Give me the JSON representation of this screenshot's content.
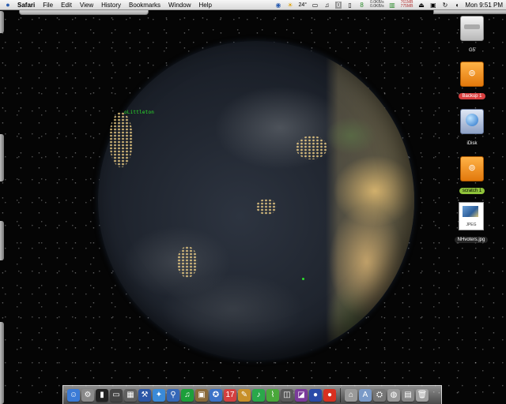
{
  "menubar": {
    "apple": "",
    "items": [
      "Safari",
      "File",
      "Edit",
      "View",
      "History",
      "Bookmarks",
      "Window",
      "Help"
    ],
    "extras": {
      "weather": "24°",
      "net_down": "0.0KB/s",
      "net_up": "0.0KB/s",
      "mem_a": "761MB",
      "mem_b": "775MB",
      "clock": "Mon 9:51 PM"
    }
  },
  "desktop_label": "oLittleton",
  "desktop_icons": [
    {
      "label": "G5"
    },
    {
      "label": "Backup 1"
    },
    {
      "label": "iDisk"
    },
    {
      "label": "scratch 1"
    },
    {
      "label": "NHvoters.jpg",
      "file_type": "JPEG"
    }
  ],
  "colors": {
    "label_backup": "#d84040",
    "label_scratch": "#8fc23a",
    "marker_green": "#2be02b"
  },
  "dock": {
    "apps": [
      {
        "name": "finder-icon",
        "glyph": "☺",
        "color": "#3b7bd6"
      },
      {
        "name": "system-prefs-icon",
        "glyph": "⚙",
        "color": "#8a8a8a"
      },
      {
        "name": "terminal-icon",
        "glyph": "▮",
        "color": "#222222"
      },
      {
        "name": "monitor-icon",
        "glyph": "▭",
        "color": "#444444"
      },
      {
        "name": "screenshot-icon",
        "glyph": "▦",
        "color": "#606060"
      },
      {
        "name": "xcode-icon",
        "glyph": "⚒",
        "color": "#2b56a6"
      },
      {
        "name": "safari-icon",
        "glyph": "✦",
        "color": "#3a8ad8"
      },
      {
        "name": "search-icon",
        "glyph": "⚲",
        "color": "#3568b8"
      },
      {
        "name": "itunes-icon",
        "glyph": "♫",
        "color": "#1c9f3a"
      },
      {
        "name": "iphoto-icon",
        "glyph": "▣",
        "color": "#8a6a3a"
      },
      {
        "name": "imovie-icon",
        "glyph": "✪",
        "color": "#3c73c8"
      },
      {
        "name": "calendar-icon",
        "glyph": "17",
        "color": "#d44040"
      },
      {
        "name": "paint-icon",
        "glyph": "✎",
        "color": "#c8902a"
      },
      {
        "name": "garageband-icon",
        "glyph": "♪",
        "color": "#2aa84a"
      },
      {
        "name": "grapher-icon",
        "glyph": "⌇",
        "color": "#4aa83a"
      },
      {
        "name": "preview-icon",
        "glyph": "◫",
        "color": "#5a5a5a"
      },
      {
        "name": "photoshop-icon",
        "glyph": "◪",
        "color": "#7a3a9a"
      },
      {
        "name": "firefox-icon",
        "glyph": "●",
        "color": "#2a4aa8"
      },
      {
        "name": "tomato-icon",
        "glyph": "●",
        "color": "#d83020"
      }
    ],
    "docs": [
      {
        "name": "home-folder-icon",
        "glyph": "⌂",
        "color": "#9a9a9a"
      },
      {
        "name": "applications-folder-icon",
        "glyph": "A",
        "color": "#7a9ac8"
      },
      {
        "name": "utility-icon",
        "glyph": "⛭",
        "color": "#777777"
      },
      {
        "name": "network-icon",
        "glyph": "◍",
        "color": "#999999"
      },
      {
        "name": "downloads-icon",
        "glyph": "▤",
        "color": "#888888"
      },
      {
        "name": "trash-icon",
        "glyph": "🗑",
        "color": "#a0a0a0"
      }
    ]
  }
}
